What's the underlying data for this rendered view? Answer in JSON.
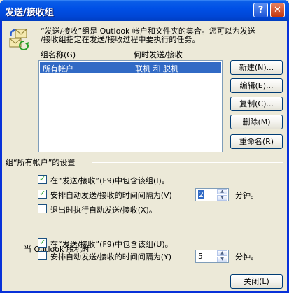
{
  "window": {
    "title": "发送/接收组",
    "help_glyph": "?",
    "close_glyph": "✕"
  },
  "description": {
    "line1": "“发送/接收”组是 Outlook 帐户和文件夹的集合。您可以为发送",
    "line2": "/接收组指定在发送/接收过程中要执行的任务。"
  },
  "list": {
    "headers": {
      "name": "组名称(G)",
      "when": "何时发送/接收"
    },
    "rows": [
      {
        "name": "所有帐户",
        "when": "联机 和 脱机",
        "selected": true
      }
    ]
  },
  "buttons": {
    "new": "新建(N)...",
    "edit": "编辑(E)...",
    "copy": "复制(C)...",
    "delete": "删除(M)",
    "rename": "重命名(R)",
    "close": "关闭(L)"
  },
  "settings": {
    "group_title": "组“所有帐户”的设置",
    "online": {
      "include": {
        "label": "在“发送/接收”(F9)中包含该组(I)。",
        "checked": true
      },
      "schedule": {
        "label": "安排自动发送/接收的时间间隔为(V)",
        "checked": true,
        "value": "2",
        "unit": "分钟。"
      },
      "on_exit": {
        "label": "退出时执行自动发送/接收(X)。",
        "checked": false
      }
    },
    "offline_title": "当 Outlook 脱机时",
    "offline": {
      "include": {
        "label": "在“发送/接收”(F9)中包含该组(U)。",
        "checked": true
      },
      "schedule": {
        "label": "安排自动发送/接收的时间间隔为(Y)",
        "checked": false,
        "value": "5",
        "unit": "分钟。"
      }
    }
  },
  "colors": {
    "title_blue": "#0050e6",
    "selection": "#316ac5",
    "dialog_bg": "#ece9d8"
  }
}
